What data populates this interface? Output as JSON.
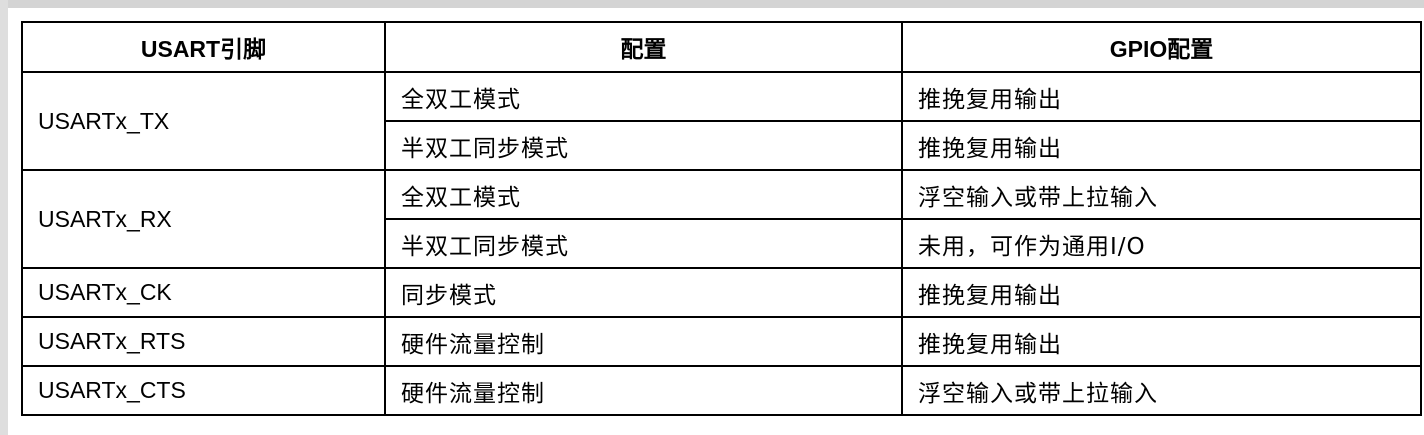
{
  "table": {
    "headers": [
      "USART引脚",
      "配置",
      "GPIO配置"
    ],
    "rows": [
      {
        "pin": "USARTx_TX",
        "configs": [
          {
            "mode": "全双工模式",
            "gpio": "推挽复用输出"
          },
          {
            "mode": "半双工同步模式",
            "gpio": "推挽复用输出"
          }
        ]
      },
      {
        "pin": "USARTx_RX",
        "configs": [
          {
            "mode": "全双工模式",
            "gpio": "浮空输入或带上拉输入"
          },
          {
            "mode": "半双工同步模式",
            "gpio": "未用，可作为通用I/O"
          }
        ]
      },
      {
        "pin": "USARTx_CK",
        "configs": [
          {
            "mode": "同步模式",
            "gpio": "推挽复用输出"
          }
        ]
      },
      {
        "pin": "USARTx_RTS",
        "configs": [
          {
            "mode": "硬件流量控制",
            "gpio": "推挽复用输出"
          }
        ]
      },
      {
        "pin": "USARTx_CTS",
        "configs": [
          {
            "mode": "硬件流量控制",
            "gpio": "浮空输入或带上拉输入"
          }
        ]
      }
    ]
  }
}
